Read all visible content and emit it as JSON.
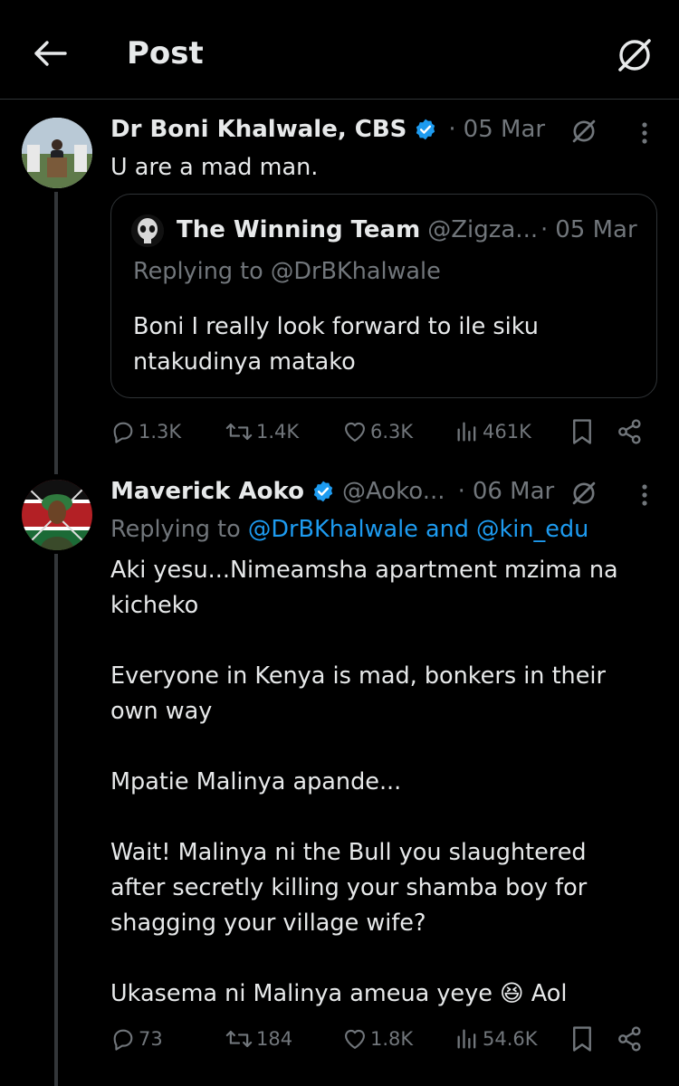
{
  "header": {
    "title": "Post",
    "back_icon": "arrow-left-icon",
    "grok_icon": "grok-icon"
  },
  "colors": {
    "background": "#000000",
    "text": "#e7e9ea",
    "muted": "#71767b",
    "link": "#1d9bf0",
    "border": "#2f3336"
  },
  "tweets": [
    {
      "name": "Dr Boni Khalwale, CBS",
      "handle": "",
      "date": "05 Mar",
      "verified": true,
      "text": "U are a mad man.",
      "quote": {
        "name": "The Winning Team",
        "handle": "@Zigza...",
        "date": "05 Mar",
        "replying_to": "Replying to @DrBKhalwale",
        "text": "Boni I really look forward to ile siku\nntakudinya matako"
      },
      "stats": {
        "replies": "1.3K",
        "reposts": "1.4K",
        "likes": "6.3K",
        "views": "461K"
      }
    },
    {
      "name": "Maverick Aoko",
      "handle": "@Aoko...",
      "date": "06 Mar",
      "verified": true,
      "replying_prefix": "Replying to",
      "replying_to": "@DrBKhalwale and @kin_edu",
      "text": "Aki yesu...Nimeamsha apartment mzima na\nkicheko\n\nEveryone in Kenya is mad, bonkers in their\nown way\n\nMpatie Malinya apande...\n\nWait! Malinya ni the Bull you slaughtered\nafter secretly killing your shamba boy for\nshagging your village wife?\n\nUkasema ni Malinya ameua yeye",
      "text_emoji": "😆",
      "text_suffix": "Aol",
      "stats": {
        "replies": "73",
        "reposts": "184",
        "likes": "1.8K",
        "views": "54.6K"
      }
    }
  ]
}
